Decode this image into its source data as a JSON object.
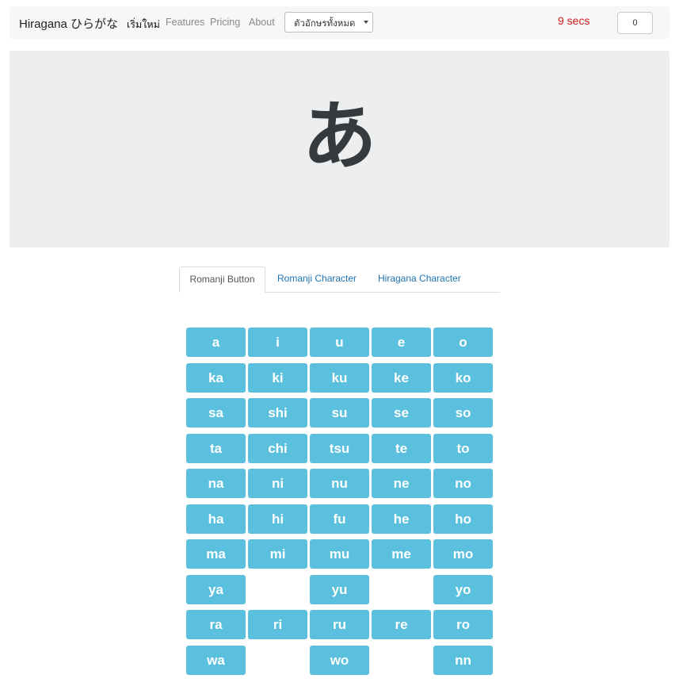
{
  "navbar": {
    "brand": "Hiragana ひらがな",
    "links": [
      "เริ่มใหม่",
      "Features",
      "Pricing",
      "About"
    ],
    "mode_select": "ตัวอักษรทั้งหมด",
    "timer": "9 secs",
    "score": "0"
  },
  "display": {
    "kana": "あ"
  },
  "tabs": [
    "Romanji Button",
    "Romanji Character",
    "Hiragana Character"
  ],
  "grid": {
    "rows": [
      [
        "a",
        "i",
        "u",
        "e",
        "o"
      ],
      [
        "ka",
        "ki",
        "ku",
        "ke",
        "ko"
      ],
      [
        "sa",
        "shi",
        "su",
        "se",
        "so"
      ],
      [
        "ta",
        "chi",
        "tsu",
        "te",
        "to"
      ],
      [
        "na",
        "ni",
        "nu",
        "ne",
        "no"
      ],
      [
        "ha",
        "hi",
        "fu",
        "he",
        "ho"
      ],
      [
        "ma",
        "mi",
        "mu",
        "me",
        "mo"
      ],
      [
        "ya",
        "",
        "yu",
        "",
        "yo"
      ],
      [
        "ra",
        "ri",
        "ru",
        "re",
        "ro"
      ],
      [
        "wa",
        "",
        "wo",
        "",
        "nn"
      ]
    ]
  },
  "colors": {
    "button": "#5bc0de",
    "timer": "#d11a1a",
    "tab_link": "#1e73b4"
  }
}
